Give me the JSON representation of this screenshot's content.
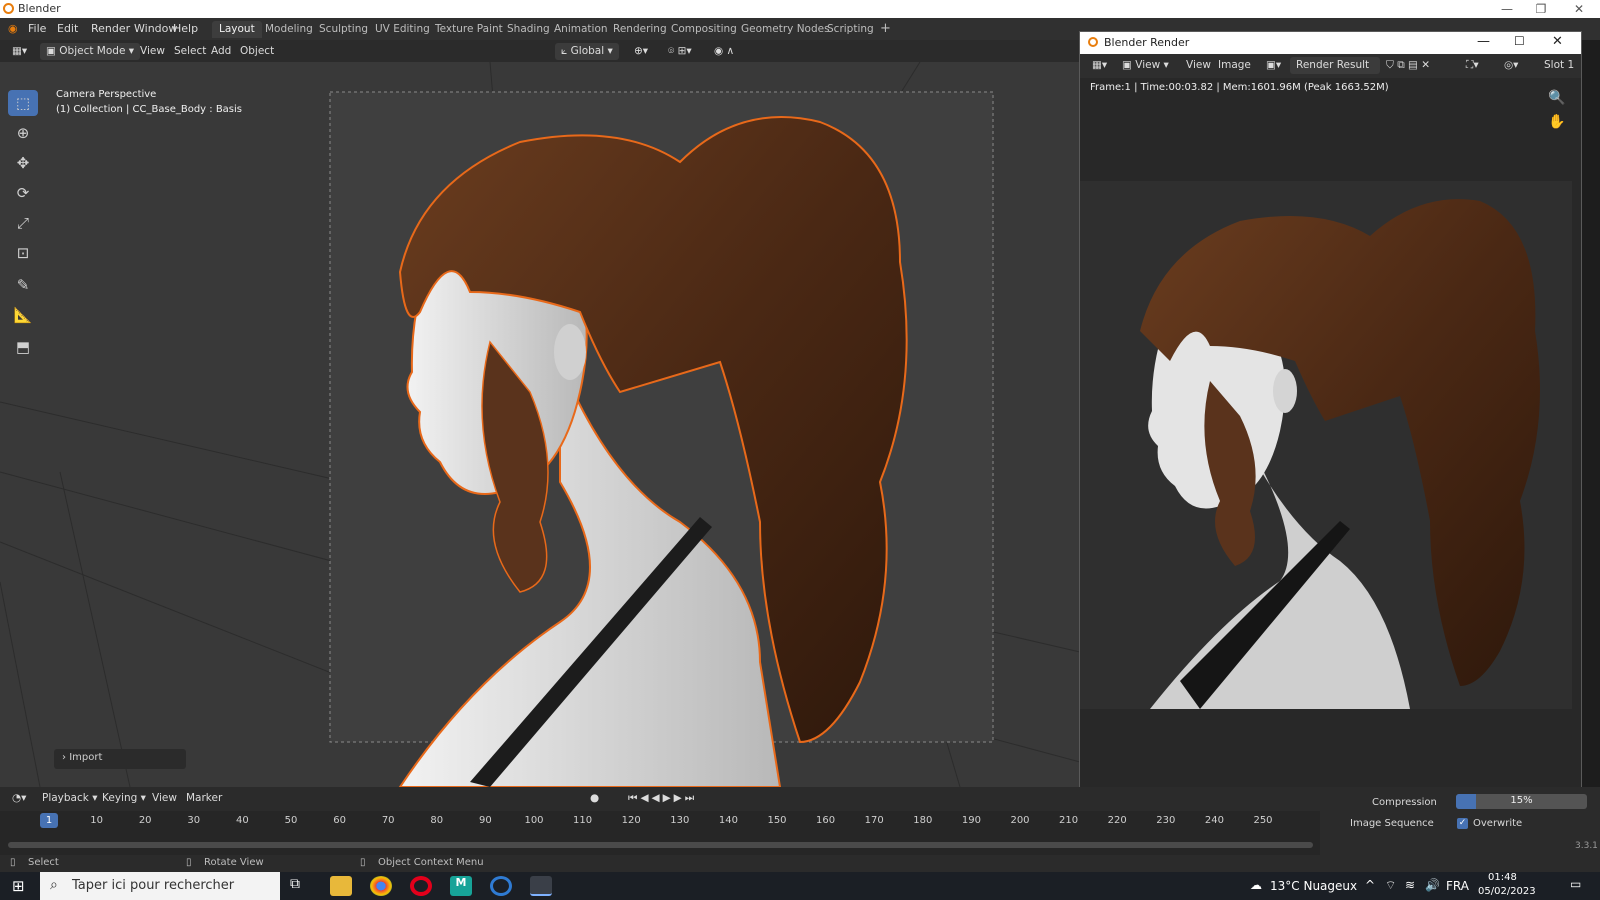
{
  "window": {
    "title": "Blender"
  },
  "menu": [
    "File",
    "Edit",
    "Render",
    "Window",
    "Help"
  ],
  "workspaces": [
    "Layout",
    "Modeling",
    "Sculpting",
    "UV Editing",
    "Texture Paint",
    "Shading",
    "Animation",
    "Rendering",
    "Compositing",
    "Geometry Nodes",
    "Scripting"
  ],
  "viewport_header": {
    "mode": "Object Mode",
    "menus": [
      "View",
      "Select",
      "Add",
      "Object"
    ],
    "orientation": "Global"
  },
  "viewport": {
    "camera_label": "Camera Perspective",
    "collection_label": "(1) Collection | CC_Base_Body : Basis",
    "import_panel": "Import"
  },
  "tools": [
    "select-box",
    "cursor",
    "move",
    "rotate",
    "scale",
    "transform",
    "annotate",
    "measure",
    "add-cube"
  ],
  "render_window": {
    "title": "Blender Render",
    "menus": [
      "View",
      "View",
      "Image"
    ],
    "image_name": "Render Result",
    "slot": "Slot 1",
    "info": "Frame:1 | Time:00:03.82 | Mem:1601.96M (Peak 1663.52M)"
  },
  "timeline": {
    "menus": [
      "Playback",
      "Keying",
      "View",
      "Marker"
    ],
    "current_frame": "1",
    "ticks": [
      "10",
      "20",
      "30",
      "40",
      "50",
      "60",
      "70",
      "80",
      "90",
      "100",
      "110",
      "120",
      "130",
      "140",
      "150",
      "160",
      "170",
      "180",
      "190",
      "200",
      "210",
      "220",
      "230",
      "240",
      "250"
    ]
  },
  "properties": {
    "compression_label": "Compression",
    "compression_value": "15%",
    "compression_fraction": 0.15,
    "image_sequence_label": "Image Sequence",
    "overwrite_label": "Overwrite",
    "overwrite_checked": true
  },
  "statusbar": {
    "select": "Select",
    "rotate": "Rotate View",
    "context": "Object Context Menu",
    "version": "3.3.1"
  },
  "taskbar": {
    "search_placeholder": "Taper ici pour rechercher",
    "weather": "13°C  Nuageux",
    "lang": "FRA",
    "time": "01:48",
    "date": "05/02/2023"
  },
  "colors": {
    "accent": "#4772b3",
    "outline": "#e8691a",
    "hair": "#5a331c",
    "skin": "#d8d8d8"
  }
}
